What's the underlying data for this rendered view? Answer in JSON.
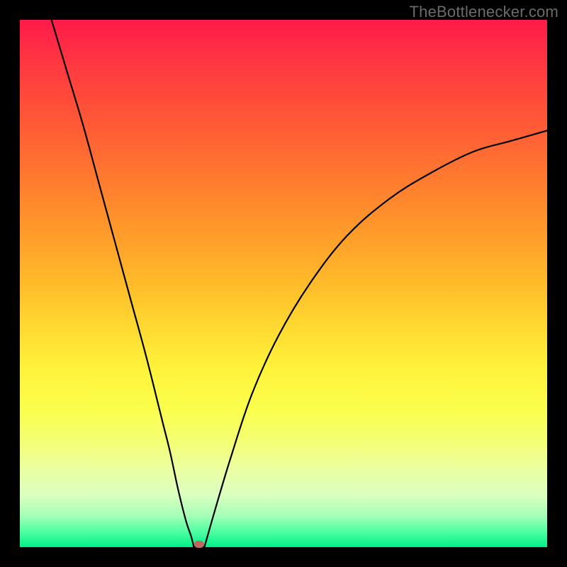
{
  "watermark": "TheBottlenecker.com",
  "chart_data": {
    "type": "line",
    "title": "",
    "xlabel": "",
    "ylabel": "",
    "xlim": [
      0,
      1
    ],
    "ylim": [
      0,
      1
    ],
    "series": [
      {
        "name": "left-branch",
        "x": [
          0.06,
          0.09,
          0.12,
          0.15,
          0.18,
          0.21,
          0.24,
          0.27,
          0.285,
          0.3,
          0.315,
          0.325,
          0.33
        ],
        "values": [
          1.0,
          0.9,
          0.8,
          0.69,
          0.58,
          0.47,
          0.36,
          0.24,
          0.18,
          0.11,
          0.05,
          0.02,
          0.0
        ]
      },
      {
        "name": "right-branch",
        "x": [
          0.35,
          0.37,
          0.4,
          0.44,
          0.49,
          0.55,
          0.62,
          0.7,
          0.78,
          0.86,
          0.93,
          1.0
        ],
        "values": [
          0.0,
          0.07,
          0.17,
          0.29,
          0.4,
          0.5,
          0.59,
          0.66,
          0.71,
          0.75,
          0.77,
          0.79
        ]
      }
    ],
    "annotations": [
      {
        "name": "optimal-marker",
        "x": 0.34,
        "y": 0.005
      }
    ],
    "gradient_stops": [
      {
        "pos": 0.0,
        "color": "#ff1b4a"
      },
      {
        "pos": 0.5,
        "color": "#ffbb2a"
      },
      {
        "pos": 0.74,
        "color": "#faff4d"
      },
      {
        "pos": 1.0,
        "color": "#00ef88"
      }
    ]
  }
}
